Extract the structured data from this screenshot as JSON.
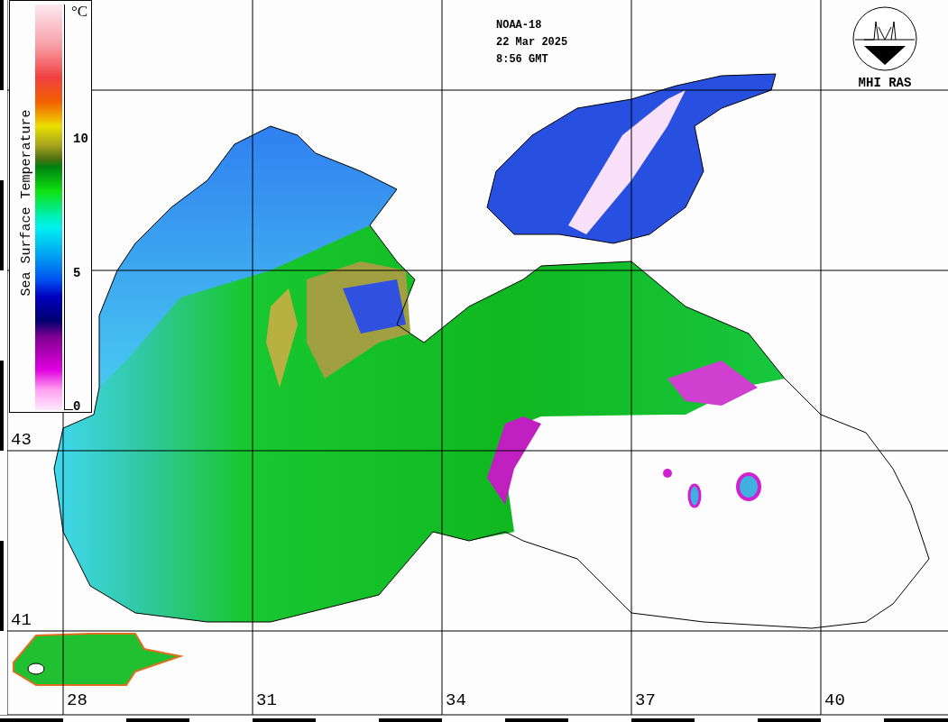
{
  "satellite_info": [
    "NOAA-18",
    "22 Mar 2025",
    "8:56 GMT"
  ],
  "logo": {
    "caption": "MHI RAS"
  },
  "legend": {
    "title": "Sea Surface Temperature",
    "unit": "°C",
    "ticks": [
      {
        "label": "10",
        "level": 0.66
      },
      {
        "label": "5",
        "level": 0.33
      },
      {
        "label": "0",
        "level": 0.0
      }
    ]
  },
  "latitude_labels": [
    "43",
    "41"
  ],
  "longitude_labels": [
    "28",
    "31",
    "34",
    "37",
    "40"
  ]
}
